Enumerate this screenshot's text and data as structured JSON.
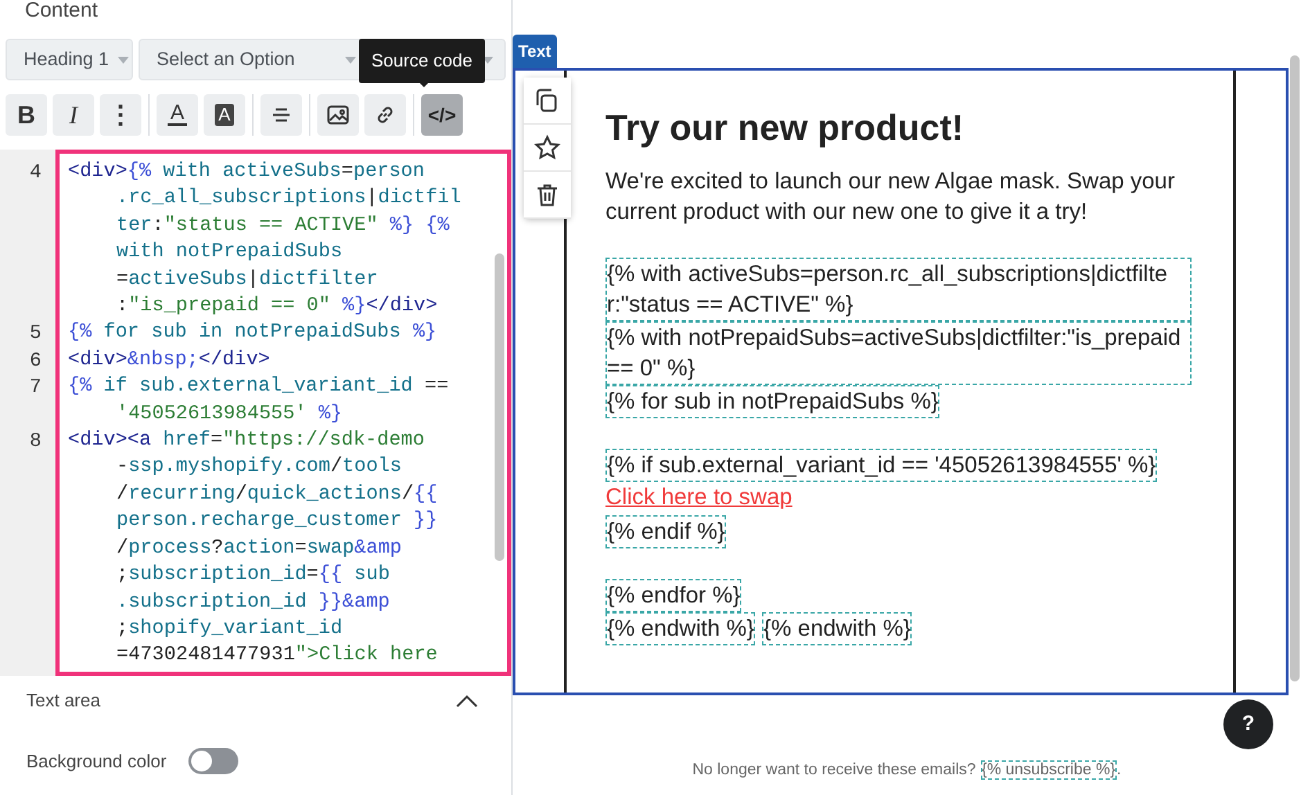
{
  "left_panel": {
    "title": "Content",
    "dropdowns": [
      {
        "label": "Heading 1"
      },
      {
        "label": "Select an Option"
      }
    ],
    "tooltip": "Source code",
    "tools": [
      {
        "kind": "bold",
        "label": "B",
        "active": false
      },
      {
        "kind": "italic",
        "label": "I",
        "active": false
      },
      {
        "kind": "more",
        "label": "⋮",
        "active": false
      },
      {
        "kind": "separator"
      },
      {
        "kind": "text-color",
        "label": "A",
        "active": false
      },
      {
        "kind": "bg-color",
        "label": "A",
        "active": false
      },
      {
        "kind": "separator"
      },
      {
        "kind": "align",
        "active": false
      },
      {
        "kind": "separator"
      },
      {
        "kind": "image",
        "active": false
      },
      {
        "kind": "link",
        "active": false
      },
      {
        "kind": "separator"
      },
      {
        "kind": "source",
        "label": "</>",
        "active": true
      }
    ],
    "code_lines": [
      {
        "number": "4",
        "rows": [
          "<div>{% with activeSubs=person",
          ".rc_all_subscriptions|dictfil",
          "ter:\"status == ACTIVE\" %} {%",
          "with notPrepaidSubs",
          "=activeSubs|dictfilter",
          ":\"is_prepaid == 0\" %}</div>"
        ]
      },
      {
        "number": "5",
        "rows": [
          "{% for sub in notPrepaidSubs %}"
        ]
      },
      {
        "number": "6",
        "rows": [
          "<div>&nbsp;</div>"
        ]
      },
      {
        "number": "7",
        "rows": [
          "{% if sub.external_variant_id ==",
          "'45052613984555' %}"
        ]
      },
      {
        "number": "8",
        "rows": [
          "<div><a href=\"https://sdk-demo",
          "-ssp.myshopify.com/tools",
          "/recurring/quick_actions/{{",
          "person.recharge_customer }}",
          "/process?action=swap&amp",
          ";subscription_id={{ sub",
          ".subscription_id }}&amp",
          ";shopify_variant_id",
          "=47302481477931\">Click here"
        ]
      }
    ],
    "section": {
      "title": "Text area",
      "expanded": true
    },
    "toggle": {
      "label": "Background color",
      "on": false
    }
  },
  "preview": {
    "block_label": "Text",
    "heading": "Try our new product!",
    "paragraph": "We're excited to launch our new Algae mask. Swap your current product with our new one to give it a try!",
    "blocks": [
      {
        "kind": "gap"
      },
      {
        "kind": "tokens",
        "tokens": [
          "{% with activeSubs=person.rc_all_subscriptions|dictfilter:\"status == ACTIVE\" %}",
          "{% with notPrepaidSubs=activeSubs|dictfilter:\"is_prepaid == 0\" %}"
        ]
      },
      {
        "kind": "tokens",
        "tokens": [
          "{% for sub in notPrepaidSubs %}"
        ]
      },
      {
        "kind": "gap"
      },
      {
        "kind": "tokens",
        "tokens": [
          "{% if sub.external_variant_id == '45052613984555' %}"
        ]
      },
      {
        "kind": "link",
        "text": "Click here to swap"
      },
      {
        "kind": "tokens",
        "tokens": [
          "{% endif %}"
        ]
      },
      {
        "kind": "gap"
      },
      {
        "kind": "tokens",
        "tokens": [
          "{% endfor %}"
        ]
      },
      {
        "kind": "tokens",
        "tokens": [
          "{% endwith %}",
          "{% endwith %}"
        ]
      }
    ],
    "footer": {
      "text": "No longer want to receive these emails?",
      "token": "{% unsubscribe %}",
      "suffix": "."
    },
    "help": "?"
  }
}
